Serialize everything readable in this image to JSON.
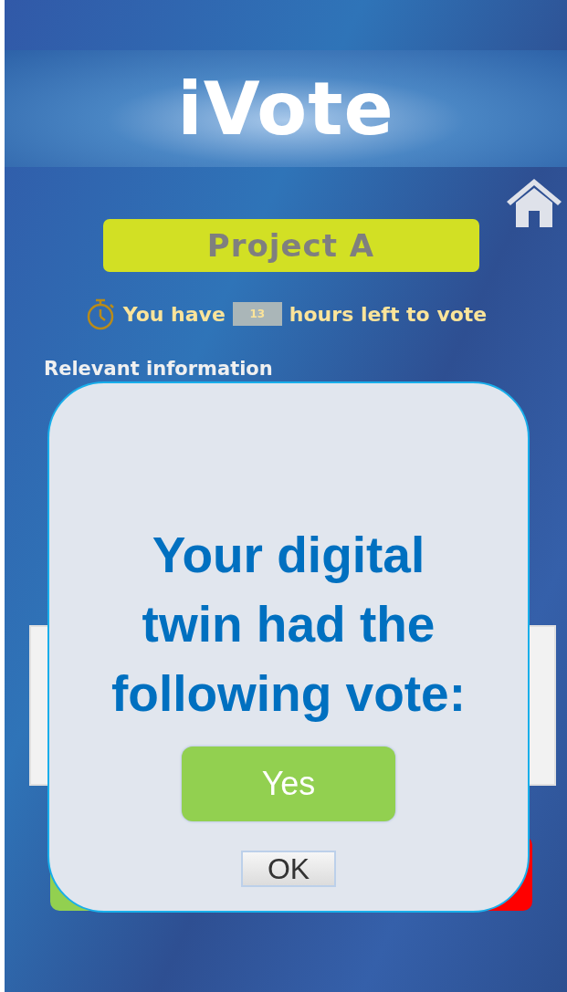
{
  "app": {
    "title": "iVote"
  },
  "project": {
    "name": "Project A"
  },
  "timer": {
    "prefix": "You have",
    "hours": "13",
    "suffix": "hours left to vote"
  },
  "info": {
    "heading": "Relevant information"
  },
  "vote_buttons": [
    {
      "kind": "yes"
    },
    {
      "kind": "no"
    }
  ],
  "dialog": {
    "message": "Your digital twin had the following vote:",
    "vote": {
      "label": "Yes",
      "kind": "yes"
    },
    "button": "OK"
  }
}
